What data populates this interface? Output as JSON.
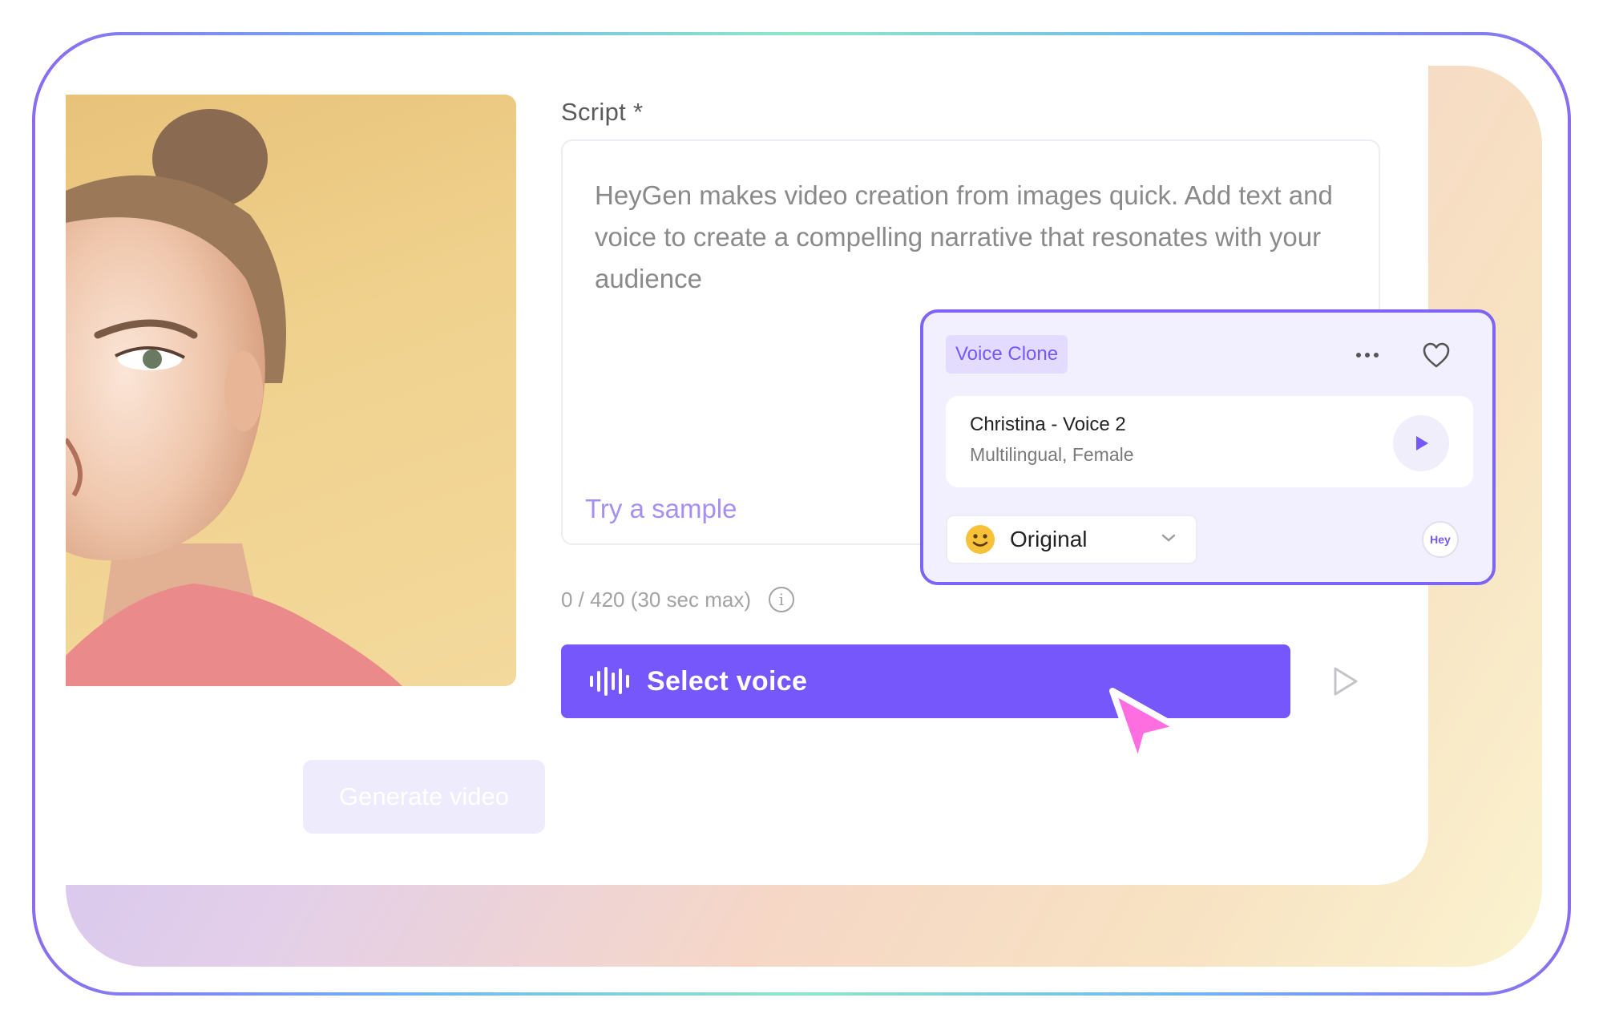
{
  "script": {
    "label": "Script *",
    "text": "HeyGen makes video creation from images quick. Add text and voice to create a compelling narrative that resonates with your audience",
    "try_sample": "Try a sample",
    "counter": "0 / 420 (30 sec max)",
    "info_glyph": "i"
  },
  "actions": {
    "select_voice": "Select voice",
    "generate_video": "Generate video"
  },
  "voice_card": {
    "badge": "Voice Clone",
    "name": "Christina - Voice 2",
    "meta": "Multilingual, Female",
    "style": "Original",
    "logo_text": "Hey"
  },
  "colors": {
    "accent": "#7557fb",
    "cursor": "#ff6ee0",
    "card_border": "#7d63f6"
  }
}
